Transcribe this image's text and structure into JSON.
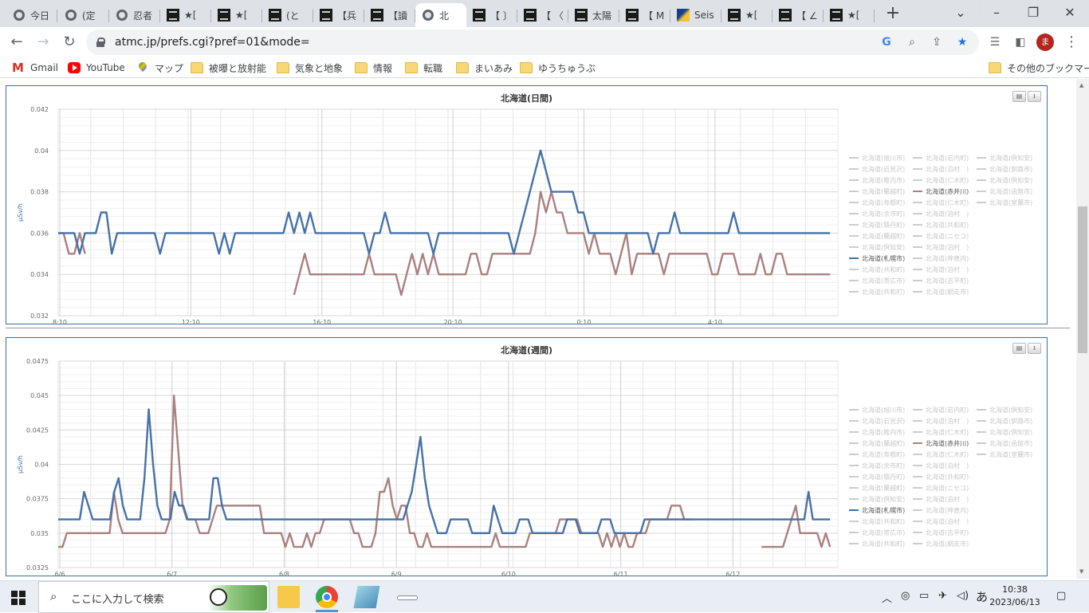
{
  "browser": {
    "tabs": [
      {
        "label": "今日",
        "icon": "globe-icon"
      },
      {
        "label": "(定",
        "icon": "globe-icon"
      },
      {
        "label": "忍者",
        "icon": "globe-icon"
      },
      {
        "label": "★[",
        "icon": "atmc-icon"
      },
      {
        "label": "★[",
        "icon": "atmc-icon"
      },
      {
        "label": "(と",
        "icon": "atmc-icon"
      },
      {
        "label": "【兵",
        "icon": "atmc-icon"
      },
      {
        "label": "【讀",
        "icon": "atmc-icon"
      },
      {
        "label": "北",
        "icon": "globe-icon",
        "active": true
      },
      {
        "label": "【 〕",
        "icon": "atmc-icon"
      },
      {
        "label": "【 〈",
        "icon": "atmc-icon"
      },
      {
        "label": "太陽",
        "icon": "atmc-icon"
      },
      {
        "label": "【 M",
        "icon": "atmc-icon"
      },
      {
        "label": "Seis",
        "icon": "seis-icon"
      },
      {
        "label": "★[",
        "icon": "atmc-icon"
      },
      {
        "label": "【 ∠",
        "icon": "atmc-icon"
      },
      {
        "label": "★[",
        "icon": "atmc-icon"
      }
    ],
    "new_tab": "+",
    "url": "atmc.jp/prefs.cgi?pref=01&mode=",
    "avatar_letter": "ま"
  },
  "bookmarks": {
    "items": [
      {
        "label": "Gmail",
        "icon": "gmail-icon"
      },
      {
        "label": "YouTube",
        "icon": "youtube-icon"
      },
      {
        "label": "マップ",
        "icon": "maps-icon"
      },
      {
        "label": "被曝と放射能",
        "icon": "folder-icon"
      },
      {
        "label": "気象と地象",
        "icon": "folder-icon"
      },
      {
        "label": "情報",
        "icon": "folder-icon"
      },
      {
        "label": "転職",
        "icon": "folder-icon"
      },
      {
        "label": "まいあみ",
        "icon": "folder-icon"
      },
      {
        "label": "ゆうちゅうぶ",
        "icon": "folder-icon"
      }
    ],
    "other": "その他のブックマーク"
  },
  "legend_entries": [
    [
      "北海道(旭川市)",
      "北海道(岩内町)",
      "北海道(倶知安)"
    ],
    [
      "北海道(岩見沢)",
      "北海道(泊村　)",
      "北海道(釧路市)"
    ],
    [
      "北海道(稚内市)",
      "北海道(仁木町)",
      "北海道(倶知安)"
    ],
    [
      "北海道(蘭越町)",
      "北海道(赤井川)",
      "北海道(函館市)"
    ],
    [
      "北海道(寿都町)",
      "北海道(仁木町)",
      "北海道(室蘭市)"
    ],
    [
      "北海道(余市町)",
      "北海道(泊村　)",
      ""
    ],
    [
      "北海道(積丹町)",
      "北海道(共和町)",
      ""
    ],
    [
      "北海道(蘭越町)",
      "北海道(ニセコ)",
      ""
    ],
    [
      "北海道(倶知安)",
      "北海道(泊村　)",
      ""
    ],
    [
      "北海道(札幌市)",
      "北海道(神恵内)",
      ""
    ],
    [
      "北海道(共和町)",
      "北海道(泊村　)",
      ""
    ],
    [
      "北海道(帯広市)",
      "北海道(古平町)",
      ""
    ],
    [
      "北海道(共和町)",
      "北海道(網走市)",
      ""
    ]
  ],
  "colors": {
    "sapporo": "#4572a7",
    "akaigawa": "#aa8080",
    "inactive": "#cccccc"
  },
  "chart_data": [
    {
      "type": "line",
      "title": "北海道(日間)",
      "ylabel": "μSv/h",
      "ylim": [
        0.032,
        0.042
      ],
      "yticks": [
        "0.042",
        "0.04",
        "0.038",
        "0.036",
        "0.034",
        "0.032"
      ],
      "xticks": [
        "8:10",
        "12:10",
        "16:10",
        "20:10",
        "0:10",
        "4:10"
      ],
      "series": [
        {
          "name": "北海道(札幌市)",
          "color": "#4572a7",
          "values": [
            0.036,
            0.036,
            0.036,
            0.036,
            0.035,
            0.036,
            0.036,
            0.036,
            0.037,
            0.037,
            0.035,
            0.036,
            0.036,
            0.036,
            0.036,
            0.036,
            0.036,
            0.036,
            0.036,
            0.035,
            0.036,
            0.036,
            0.036,
            0.036,
            0.036,
            0.036,
            0.036,
            0.036,
            0.036,
            0.036,
            0.035,
            0.036,
            0.035,
            0.036,
            0.036,
            0.036,
            0.036,
            0.036,
            0.036,
            0.036,
            0.036,
            0.036,
            0.036,
            0.037,
            0.036,
            0.037,
            0.036,
            0.037,
            0.036,
            0.036,
            0.036,
            0.036,
            0.036,
            0.036,
            0.036,
            0.036,
            0.036,
            0.036,
            0.035,
            0.036,
            0.036,
            0.037,
            0.036,
            0.036,
            0.036,
            0.036,
            0.036,
            0.036,
            0.036,
            0.036,
            0.035,
            0.036,
            0.036,
            0.036,
            0.036,
            0.036,
            0.036,
            0.036,
            0.036,
            0.036,
            0.036,
            0.036,
            0.036,
            0.036,
            0.036,
            0.035,
            0.036,
            0.037,
            0.038,
            0.039,
            0.04,
            0.039,
            0.038,
            0.038,
            0.038,
            0.038,
            0.038,
            0.037,
            0.037,
            0.036,
            0.036,
            0.036,
            0.036,
            0.036,
            0.036,
            0.036,
            0.036,
            0.036,
            0.036,
            0.036,
            0.036,
            0.035,
            0.036,
            0.036,
            0.036,
            0.037,
            0.036,
            0.036,
            0.036,
            0.036,
            0.036,
            0.036,
            0.036,
            0.036,
            0.036,
            0.036,
            0.037,
            0.036,
            0.036,
            0.036,
            0.036,
            0.036,
            0.036,
            0.036,
            0.036,
            0.036,
            0.036,
            0.036,
            0.036,
            0.036,
            0.036,
            0.036,
            0.036,
            0.036,
            0.036
          ]
        },
        {
          "name": "北海道(赤井川)",
          "color": "#aa8080",
          "values": [
            0.036,
            0.036,
            0.035,
            0.035,
            0.036,
            0.035,
            null,
            null,
            null,
            null,
            null,
            null,
            null,
            null,
            null,
            null,
            null,
            null,
            null,
            null,
            null,
            null,
            null,
            null,
            null,
            null,
            null,
            null,
            null,
            null,
            null,
            null,
            null,
            null,
            null,
            null,
            null,
            null,
            null,
            null,
            null,
            null,
            null,
            null,
            0.033,
            0.034,
            0.035,
            0.034,
            0.034,
            0.034,
            0.034,
            0.034,
            0.034,
            0.034,
            0.034,
            0.034,
            0.034,
            0.034,
            0.035,
            0.034,
            0.034,
            0.034,
            0.034,
            0.034,
            0.033,
            0.034,
            0.035,
            0.034,
            0.035,
            0.034,
            0.035,
            0.034,
            0.034,
            0.034,
            0.034,
            0.034,
            0.034,
            0.035,
            0.035,
            0.034,
            0.034,
            0.035,
            0.035,
            0.035,
            0.035,
            0.035,
            0.035,
            0.035,
            0.035,
            0.036,
            0.038,
            0.037,
            0.038,
            0.037,
            0.037,
            0.036,
            0.036,
            0.036,
            0.036,
            0.035,
            0.036,
            0.035,
            0.035,
            0.035,
            0.034,
            0.035,
            0.036,
            0.034,
            0.035,
            0.035,
            0.035,
            0.035,
            0.035,
            0.034,
            0.035,
            0.035,
            0.035,
            0.035,
            0.035,
            0.035,
            0.035,
            0.035,
            0.034,
            0.034,
            0.035,
            0.035,
            0.035,
            0.034,
            0.034,
            0.034,
            0.034,
            0.035,
            0.034,
            0.034,
            0.035,
            0.035,
            0.034,
            0.034,
            0.034,
            0.034,
            0.034,
            0.034,
            0.034,
            0.034,
            0.034
          ]
        }
      ]
    },
    {
      "type": "line",
      "title": "北海道(週間)",
      "ylabel": "μSv/h",
      "ylim": [
        0.0325,
        0.0475
      ],
      "yticks": [
        "0.0475",
        "0.045",
        "0.0425",
        "0.04",
        "0.0375",
        "0.035",
        "0.0325"
      ],
      "xticks": [
        "6/6",
        "6/7",
        "6/8",
        "6/9",
        "6/10",
        "6/11",
        "6/12"
      ],
      "series": [
        {
          "name": "北海道(札幌市)",
          "color": "#4572a7",
          "values": [
            0.036,
            0.036,
            0.036,
            0.036,
            0.036,
            0.036,
            0.038,
            0.037,
            0.036,
            0.036,
            0.036,
            0.036,
            0.036,
            0.038,
            0.039,
            0.037,
            0.036,
            0.036,
            0.036,
            0.036,
            0.039,
            0.044,
            0.04,
            0.037,
            0.036,
            0.036,
            0.036,
            0.038,
            0.037,
            0.037,
            0.036,
            0.036,
            0.036,
            0.036,
            0.036,
            0.036,
            0.039,
            0.039,
            0.037,
            0.036,
            0.036,
            0.036,
            0.036,
            0.036,
            0.036,
            0.036,
            0.036,
            0.036,
            0.036,
            0.036,
            0.036,
            0.036,
            0.036,
            0.036,
            0.036,
            0.036,
            0.036,
            0.036,
            0.036,
            0.036,
            0.036,
            0.036,
            0.036,
            0.036,
            0.036,
            0.036,
            0.036,
            0.036,
            0.036,
            0.036,
            0.036,
            0.036,
            0.036,
            0.036,
            0.036,
            0.036,
            0.036,
            0.036,
            0.036,
            0.036,
            0.036,
            0.037,
            0.038,
            0.04,
            0.042,
            0.039,
            0.037,
            0.036,
            0.035,
            0.035,
            0.035,
            0.036,
            0.036,
            0.036,
            0.036,
            0.036,
            0.035,
            0.035,
            0.035,
            0.035,
            0.035,
            0.037,
            0.036,
            0.035,
            0.035,
            0.035,
            0.035,
            0.036,
            0.036,
            0.036,
            0.035,
            0.035,
            0.035,
            0.035,
            0.035,
            0.035,
            0.035,
            0.035,
            0.036,
            0.036,
            0.036,
            0.035,
            0.035,
            0.035,
            0.035,
            0.035,
            0.036,
            0.036,
            0.036,
            0.035,
            0.035,
            0.035,
            0.035,
            0.035,
            0.035,
            0.035,
            0.036,
            0.036,
            0.036,
            0.036,
            0.036,
            0.036,
            0.036,
            0.036,
            0.036,
            0.036,
            0.036,
            0.036,
            0.036,
            0.036,
            0.036,
            0.036,
            0.036,
            0.036,
            0.036,
            0.036,
            0.036,
            0.036,
            0.036,
            0.036,
            0.036,
            0.036,
            0.036,
            0.036,
            0.036,
            0.036,
            0.036,
            0.036,
            0.036,
            0.036,
            0.036,
            0.036,
            0.036,
            0.036,
            0.038,
            0.036,
            0.036,
            0.036,
            0.036,
            0.036
          ]
        },
        {
          "name": "北海道(赤井川)",
          "color": "#aa8080",
          "values": [
            0.034,
            0.034,
            0.035,
            0.035,
            0.035,
            0.035,
            0.035,
            0.035,
            0.035,
            0.035,
            0.035,
            0.035,
            0.035,
            0.038,
            0.036,
            0.035,
            0.035,
            0.035,
            0.035,
            0.035,
            0.035,
            0.035,
            0.035,
            0.035,
            0.035,
            0.035,
            0.036,
            0.045,
            0.041,
            0.037,
            0.036,
            0.036,
            0.036,
            0.035,
            0.035,
            0.035,
            0.036,
            0.037,
            0.037,
            0.037,
            0.037,
            0.037,
            0.037,
            0.037,
            0.037,
            0.037,
            0.037,
            0.037,
            0.035,
            0.035,
            0.035,
            0.035,
            0.035,
            0.034,
            0.035,
            0.034,
            0.034,
            0.034,
            0.035,
            0.034,
            0.035,
            0.035,
            0.036,
            0.036,
            0.036,
            0.036,
            0.036,
            0.036,
            0.036,
            0.035,
            0.035,
            0.034,
            0.034,
            0.034,
            0.035,
            0.038,
            0.038,
            0.039,
            0.037,
            0.036,
            0.037,
            0.037,
            0.035,
            0.035,
            0.034,
            0.034,
            0.035,
            0.034,
            0.034,
            0.034,
            0.034,
            0.034,
            0.034,
            0.034,
            0.034,
            0.034,
            0.034,
            0.034,
            0.034,
            0.034,
            0.034,
            0.034,
            0.035,
            0.034,
            0.034,
            0.034,
            0.034,
            0.034,
            0.034,
            0.034,
            0.035,
            0.035,
            0.035,
            0.035,
            0.035,
            0.035,
            0.035,
            0.036,
            0.036,
            0.036,
            0.036,
            0.036,
            0.035,
            0.035,
            0.035,
            0.035,
            0.035,
            0.034,
            0.035,
            0.034,
            0.035,
            0.034,
            0.035,
            0.034,
            0.034,
            0.035,
            0.035,
            0.035,
            0.036,
            0.036,
            0.036,
            0.036,
            0.036,
            0.037,
            0.037,
            0.037,
            0.036,
            0.036,
            0.036,
            null,
            null,
            null,
            null,
            null,
            null,
            null,
            null,
            null,
            null,
            null,
            null,
            null,
            null,
            null,
            0.034,
            0.034,
            0.034,
            0.034,
            0.034,
            0.034,
            0.035,
            0.036,
            0.037,
            0.035,
            0.035,
            0.035,
            0.035,
            0.035,
            0.034,
            0.035,
            0.034
          ]
        }
      ]
    }
  ],
  "taskbar": {
    "search_placeholder": "ここに入力して検索",
    "time": "10:38",
    "date": "2023/06/13",
    "ime": "あ"
  }
}
